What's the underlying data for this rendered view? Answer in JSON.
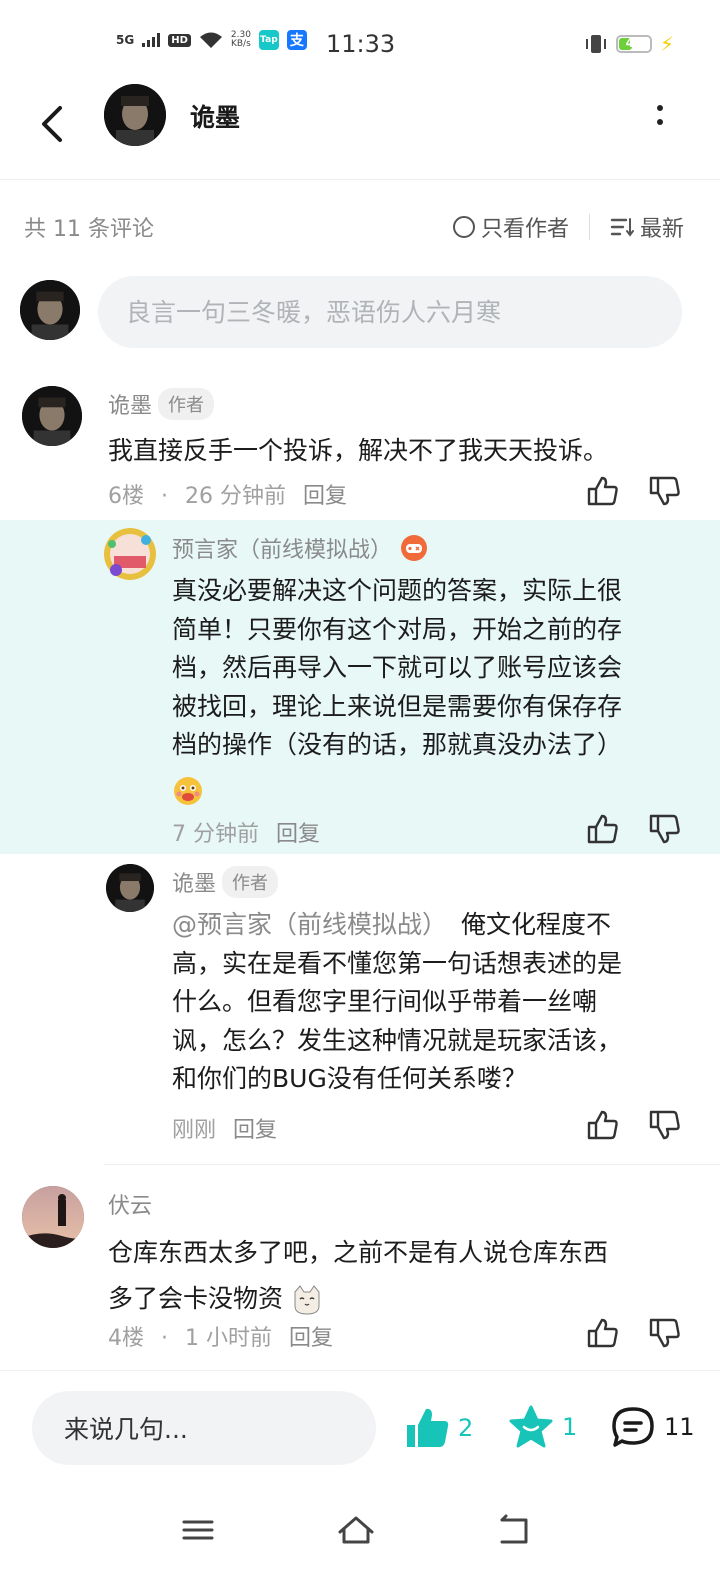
{
  "status_bar": {
    "network": "5G",
    "hd": "HD",
    "speed_value": "2.30",
    "speed_unit": "KB/s",
    "app1": "Tap",
    "app2": "支",
    "time": "11:33",
    "battery": "41",
    "battery_level": 0.41
  },
  "header": {
    "title": "诡墨"
  },
  "sort_bar": {
    "count": "共 11 条评论",
    "author_only": "只看作者",
    "sort": "最新"
  },
  "compose": {
    "placeholder": "良言一句三冬暖，恶语伤人六月寒"
  },
  "comments": [
    {
      "name": "诡墨",
      "tag": "作者",
      "text": "我直接反手一个投诉，解决不了我天天投诉。",
      "floor": "6楼",
      "dot": "·",
      "time": "26 分钟前",
      "reply": "回复",
      "replies": [
        {
          "name": "预言家（前线模拟战）",
          "text_lines": [
            "真没必要解决这个问题的答案，实际上很",
            "简单！只要你有这个对局，开始之前的存",
            "档，然后再导入一下就可以了账号应该会",
            "被找回，理论上来说但是需要你有保存存",
            "档的操作（没有的话，那就真没办法了）"
          ],
          "time": "7 分钟前",
          "reply": "回复"
        },
        {
          "name": "诡墨",
          "tag": "作者",
          "mention": "@预言家（前线模拟战）",
          "text_first": "俺文化程度不",
          "text_lines": [
            "高，实在是看不懂您第一句话想表述的是",
            "什么。但看您字里行间似乎带着一丝嘲",
            "讽，怎么？发生这种情况就是玩家活该，",
            "和你们的BUG没有任何关系喽？"
          ],
          "time": "刚刚",
          "reply": "回复"
        }
      ]
    },
    {
      "name": "伏云",
      "text_lines": [
        "仓库东西太多了吧，之前不是有人说仓库东西",
        "多了会卡没物资"
      ],
      "floor": "4楼",
      "dot": "·",
      "time": "1 小时前",
      "reply": "回复"
    }
  ],
  "bottom_bar": {
    "placeholder": "来说几句...",
    "likes": "2",
    "favorites": "1",
    "comments": "11"
  },
  "colors": {
    "accent": "#18c4b8",
    "highlight_bg": "#e8f8f7",
    "secondary_text": "#8a8a8a"
  }
}
